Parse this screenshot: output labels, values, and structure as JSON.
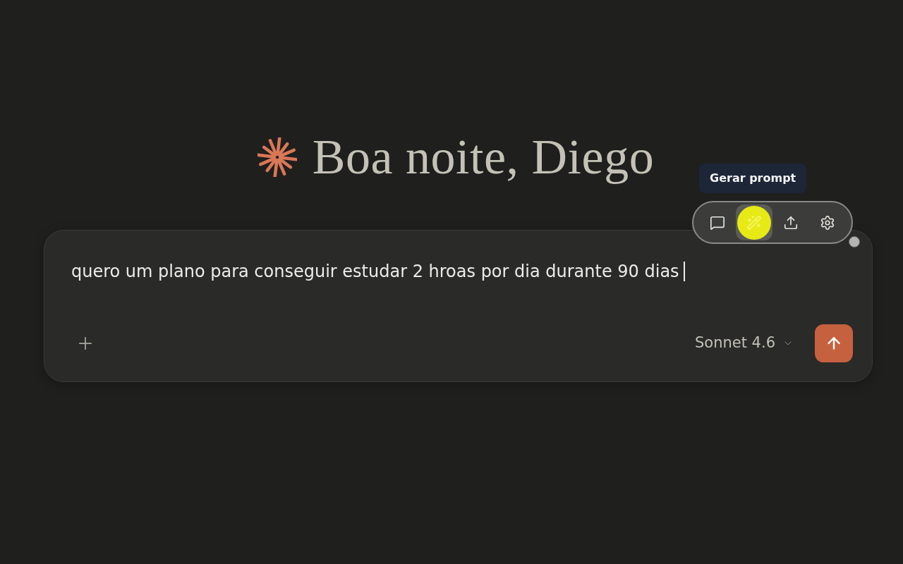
{
  "greeting": {
    "text": "Boa noite, Diego"
  },
  "composer": {
    "value": "quero um plano para conseguir estudar 2 hroas por dia durante 90 dias",
    "model": "Sonnet 4.6"
  },
  "toolbar": {
    "tooltip": "Gerar prompt",
    "buttons": [
      {
        "kind": "chat",
        "selected": false
      },
      {
        "kind": "wand",
        "selected": true
      },
      {
        "kind": "upload",
        "selected": false
      },
      {
        "kind": "settings",
        "selected": false
      }
    ]
  }
}
